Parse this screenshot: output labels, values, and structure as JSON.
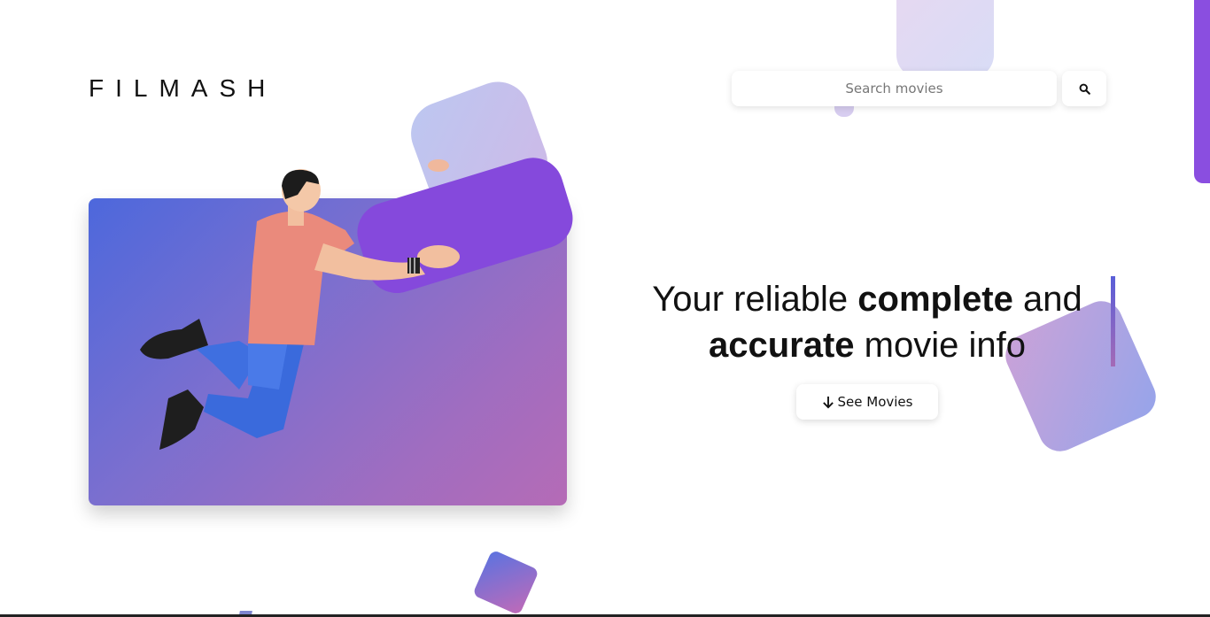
{
  "brand": {
    "logo_text": "FILMASH"
  },
  "search": {
    "placeholder": "Search movies",
    "button_icon": "search-icon"
  },
  "hero": {
    "headline_part1": "Your reliable ",
    "headline_bold1": "complete",
    "headline_part2": " and ",
    "headline_bold2": "accurate",
    "headline_part3": " movie info",
    "cta_label": "See Movies",
    "cta_icon": "arrow-down-icon"
  },
  "colors": {
    "accent": "#8a4ee0",
    "gradient_start": "#4d68dc",
    "gradient_end": "#b56bb6"
  }
}
